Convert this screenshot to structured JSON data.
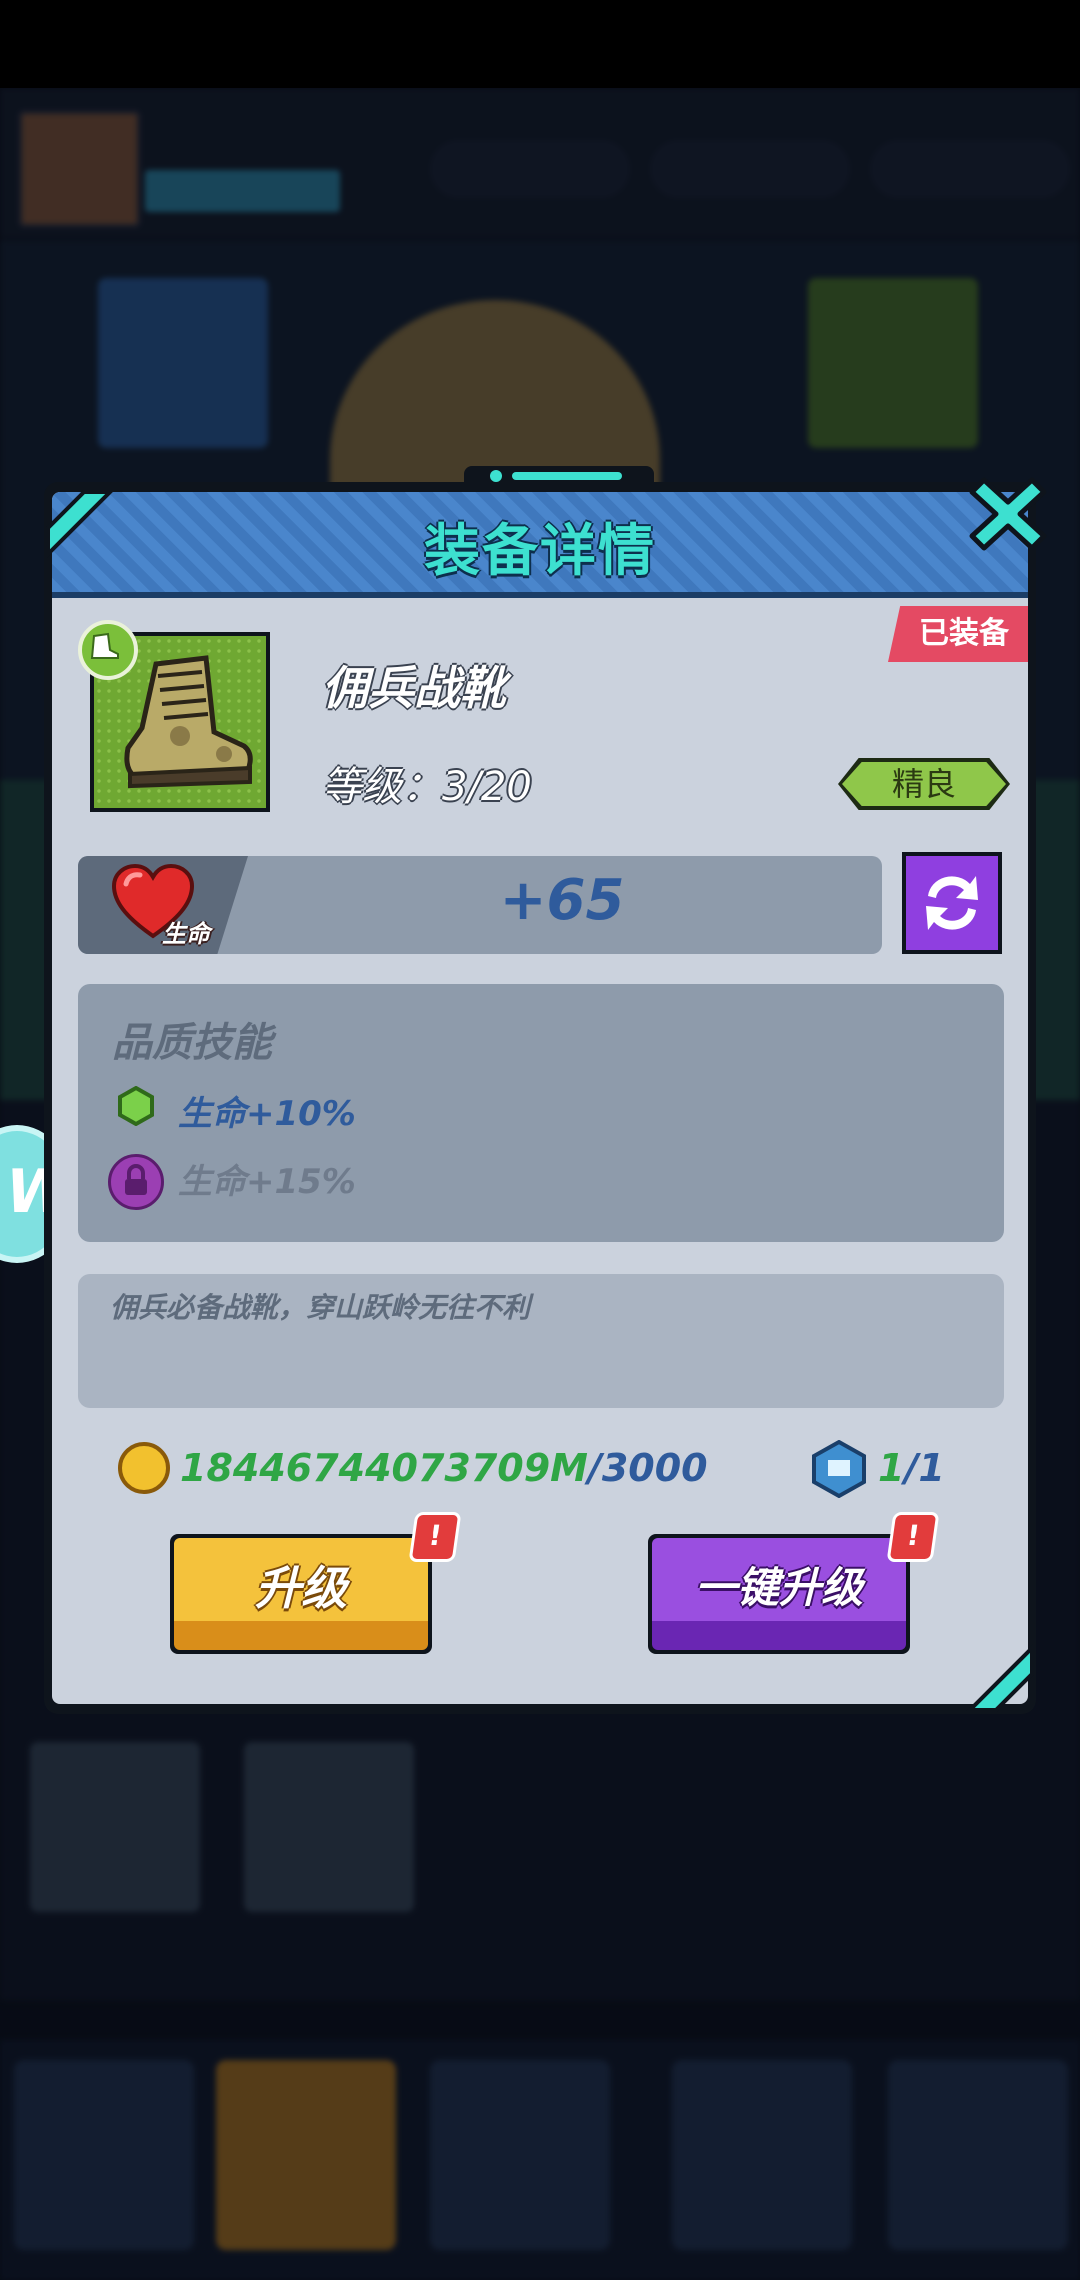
{
  "dialog": {
    "title": "装备详情",
    "equipped_badge": "已装备"
  },
  "item": {
    "name": "佣兵战靴",
    "level_text": "等级：3/20",
    "quality": "精良",
    "icon": "combat-boot-icon"
  },
  "stat": {
    "label": "生命",
    "value": "+65",
    "icon": "heart-icon"
  },
  "quality_skills": {
    "title": "品质技能",
    "items": [
      {
        "text": "生命+10%",
        "icon": "green-hexagon-icon",
        "locked": false
      },
      {
        "text": "生命+15%",
        "icon": "lock-icon",
        "locked": true
      }
    ]
  },
  "description": "佣兵必备战靴，穿山跃岭无往不利",
  "cost": {
    "coin_have": "18446744073709M",
    "coin_need": "/3000",
    "stone_have": "1",
    "stone_need": "/1"
  },
  "buttons": {
    "upgrade": "升级",
    "one_click_upgrade": "一键升级",
    "alert_mark": "!"
  },
  "colors": {
    "header_blue": "#4a86cc",
    "title_teal": "#3de0d0",
    "equipped_red": "#e44a63",
    "quality_green": "#8fc74a",
    "upgrade_yellow": "#f4c23c",
    "oneclick_purple": "#9a4fe0",
    "coin_have_green": "#2fa645",
    "value_blue": "#2f5b9c"
  }
}
